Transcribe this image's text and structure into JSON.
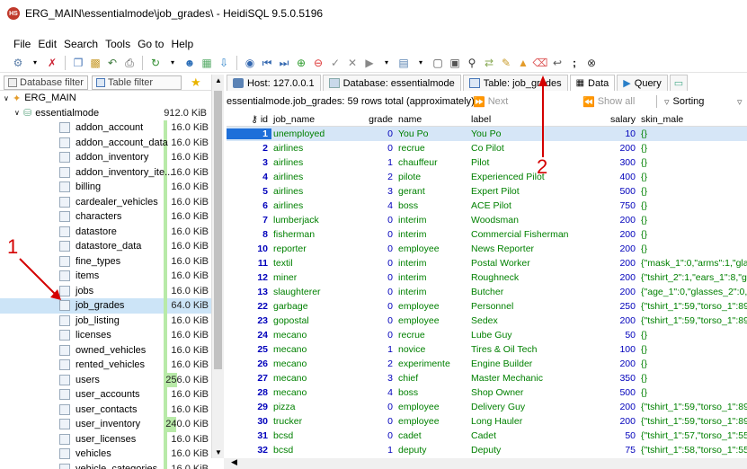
{
  "window": {
    "title": "ERG_MAIN\\essentialmode\\job_grades\\ - HeidiSQL 9.5.0.5196",
    "app_icon_text": "HS"
  },
  "menu": [
    "File",
    "Edit",
    "Search",
    "Tools",
    "Go to",
    "Help"
  ],
  "left_tabs": {
    "database_filter": "Database filter",
    "table_filter": "Table filter"
  },
  "tree": {
    "server": "ERG_MAIN",
    "database": {
      "name": "essentialmode",
      "size": "912.0 KiB"
    },
    "tables": [
      {
        "name": "addon_account",
        "size": "16.0 KiB",
        "bar": 0.02
      },
      {
        "name": "addon_account_data",
        "size": "16.0 KiB",
        "bar": 0.02
      },
      {
        "name": "addon_inventory",
        "size": "16.0 KiB",
        "bar": 0.02
      },
      {
        "name": "addon_inventory_ite...",
        "size": "16.0 KiB",
        "bar": 0.02
      },
      {
        "name": "billing",
        "size": "16.0 KiB",
        "bar": 0.02
      },
      {
        "name": "cardealer_vehicles",
        "size": "16.0 KiB",
        "bar": 0.02
      },
      {
        "name": "characters",
        "size": "16.0 KiB",
        "bar": 0.02
      },
      {
        "name": "datastore",
        "size": "16.0 KiB",
        "bar": 0.02
      },
      {
        "name": "datastore_data",
        "size": "16.0 KiB",
        "bar": 0.02
      },
      {
        "name": "fine_types",
        "size": "16.0 KiB",
        "bar": 0.02
      },
      {
        "name": "items",
        "size": "16.0 KiB",
        "bar": 0.02
      },
      {
        "name": "jobs",
        "size": "16.0 KiB",
        "bar": 0.02
      },
      {
        "name": "job_grades",
        "size": "64.0 KiB",
        "bar": 0.07,
        "selected": true
      },
      {
        "name": "job_listing",
        "size": "16.0 KiB",
        "bar": 0.02
      },
      {
        "name": "licenses",
        "size": "16.0 KiB",
        "bar": 0.02
      },
      {
        "name": "owned_vehicles",
        "size": "16.0 KiB",
        "bar": 0.02
      },
      {
        "name": "rented_vehicles",
        "size": "16.0 KiB",
        "bar": 0.02
      },
      {
        "name": "users",
        "size": "256.0 KiB",
        "bar": 0.28
      },
      {
        "name": "user_accounts",
        "size": "16.0 KiB",
        "bar": 0.02
      },
      {
        "name": "user_contacts",
        "size": "16.0 KiB",
        "bar": 0.02
      },
      {
        "name": "user_inventory",
        "size": "240.0 KiB",
        "bar": 0.26
      },
      {
        "name": "user_licenses",
        "size": "16.0 KiB",
        "bar": 0.02
      },
      {
        "name": "vehicles",
        "size": "16.0 KiB",
        "bar": 0.02
      },
      {
        "name": "vehicle_categories",
        "size": "16.0 KiB",
        "bar": 0.02
      }
    ]
  },
  "tabs": {
    "host": "Host: 127.0.0.1",
    "database": "Database: essentialmode",
    "table": "Table: job_grades",
    "data": "Data",
    "query": "Query"
  },
  "info": {
    "summary": "essentialmode.job_grades: 59 rows total (approximately)",
    "next": "Next",
    "show_all": "Show all",
    "sorting": "Sorting"
  },
  "grid": {
    "columns": [
      "id",
      "job_name",
      "grade",
      "name",
      "label",
      "salary",
      "skin_male"
    ],
    "rows": [
      [
        "1",
        "unemployed",
        "0",
        "You Po",
        "You Po",
        "10",
        "{}"
      ],
      [
        "2",
        "airlines",
        "0",
        "recrue",
        "Co Pilot",
        "200",
        "{}"
      ],
      [
        "3",
        "airlines",
        "1",
        "chauffeur",
        "Pilot",
        "300",
        "{}"
      ],
      [
        "4",
        "airlines",
        "2",
        "pilote",
        "Experienced Pilot",
        "400",
        "{}"
      ],
      [
        "5",
        "airlines",
        "3",
        "gerant",
        "Expert Pilot",
        "500",
        "{}"
      ],
      [
        "6",
        "airlines",
        "4",
        "boss",
        "ACE Pilot",
        "750",
        "{}"
      ],
      [
        "7",
        "lumberjack",
        "0",
        "interim",
        "Woodsman",
        "200",
        "{}"
      ],
      [
        "8",
        "fisherman",
        "0",
        "interim",
        "Commercial Fisherman",
        "200",
        "{}"
      ],
      [
        "10",
        "reporter",
        "0",
        "employee",
        "News Reporter",
        "200",
        "{}"
      ],
      [
        "11",
        "textil",
        "0",
        "interim",
        "Postal Worker",
        "200",
        "{\"mask_1\":0,\"arms\":1,\"glasses_1\":0,\"ha"
      ],
      [
        "12",
        "miner",
        "0",
        "interim",
        "Roughneck",
        "200",
        "{\"tshirt_2\":1,\"ears_1\":8,\"glasses_1\":15"
      ],
      [
        "13",
        "slaughterer",
        "0",
        "interim",
        "Butcher",
        "200",
        "{\"age_1\":0,\"glasses_2\":0,\"beard_1\":5,"
      ],
      [
        "22",
        "garbage",
        "0",
        "employee",
        "Personnel",
        "250",
        "{\"tshirt_1\":59,\"torso_1\":89,\"arms\":31,\""
      ],
      [
        "23",
        "gopostal",
        "0",
        "employee",
        "Sedex",
        "200",
        "{\"tshirt_1\":59,\"torso_1\":89,\"arms\":31,\""
      ],
      [
        "24",
        "mecano",
        "0",
        "recrue",
        "Lube Guy",
        "50",
        "{}"
      ],
      [
        "25",
        "mecano",
        "1",
        "novice",
        "Tires & Oil Tech",
        "100",
        "{}"
      ],
      [
        "26",
        "mecano",
        "2",
        "experimente",
        "Engine Builder",
        "200",
        "{}"
      ],
      [
        "27",
        "mecano",
        "3",
        "chief",
        "Master Mechanic",
        "350",
        "{}"
      ],
      [
        "28",
        "mecano",
        "4",
        "boss",
        "Shop Owner",
        "500",
        "{}"
      ],
      [
        "29",
        "pizza",
        "0",
        "employee",
        "Delivery Guy",
        "200",
        "{\"tshirt_1\":59,\"torso_1\":89,\"arms\":31,\""
      ],
      [
        "30",
        "trucker",
        "0",
        "employee",
        "Long Hauler",
        "200",
        "{\"tshirt_1\":59,\"torso_1\":89,\"arms\":31,\""
      ],
      [
        "31",
        "bcsd",
        "0",
        "cadet",
        "Cadet",
        "50",
        "{\"tshirt_1\":57,\"torso_1\":55,\"arms\":0,\"p"
      ],
      [
        "32",
        "bcsd",
        "1",
        "deputy",
        "Deputy",
        "75",
        "{\"tshirt_1\":58,\"torso_1\":55,\"shoes\":24,"
      ],
      [
        "33",
        "bcsd",
        "2",
        "deputy2",
        "Deputy II",
        "100",
        "{\"tshirt_1\":58,\"torso_1\":55,\"shoes\":24,"
      ],
      [
        "34",
        "bcsd",
        "3",
        "deputy3",
        "Deputy III",
        "115",
        "{\"tshirt_1\":58,\"torso_1\":55,\"shoes\":24,"
      ]
    ]
  },
  "annotations": {
    "one": "1",
    "two": "2"
  },
  "colors": {
    "annotation": "#d40000",
    "selection": "#1e6fd9",
    "string_text": "#008000",
    "number_text": "#0000bb",
    "size_bar": "#b8eaa8"
  }
}
